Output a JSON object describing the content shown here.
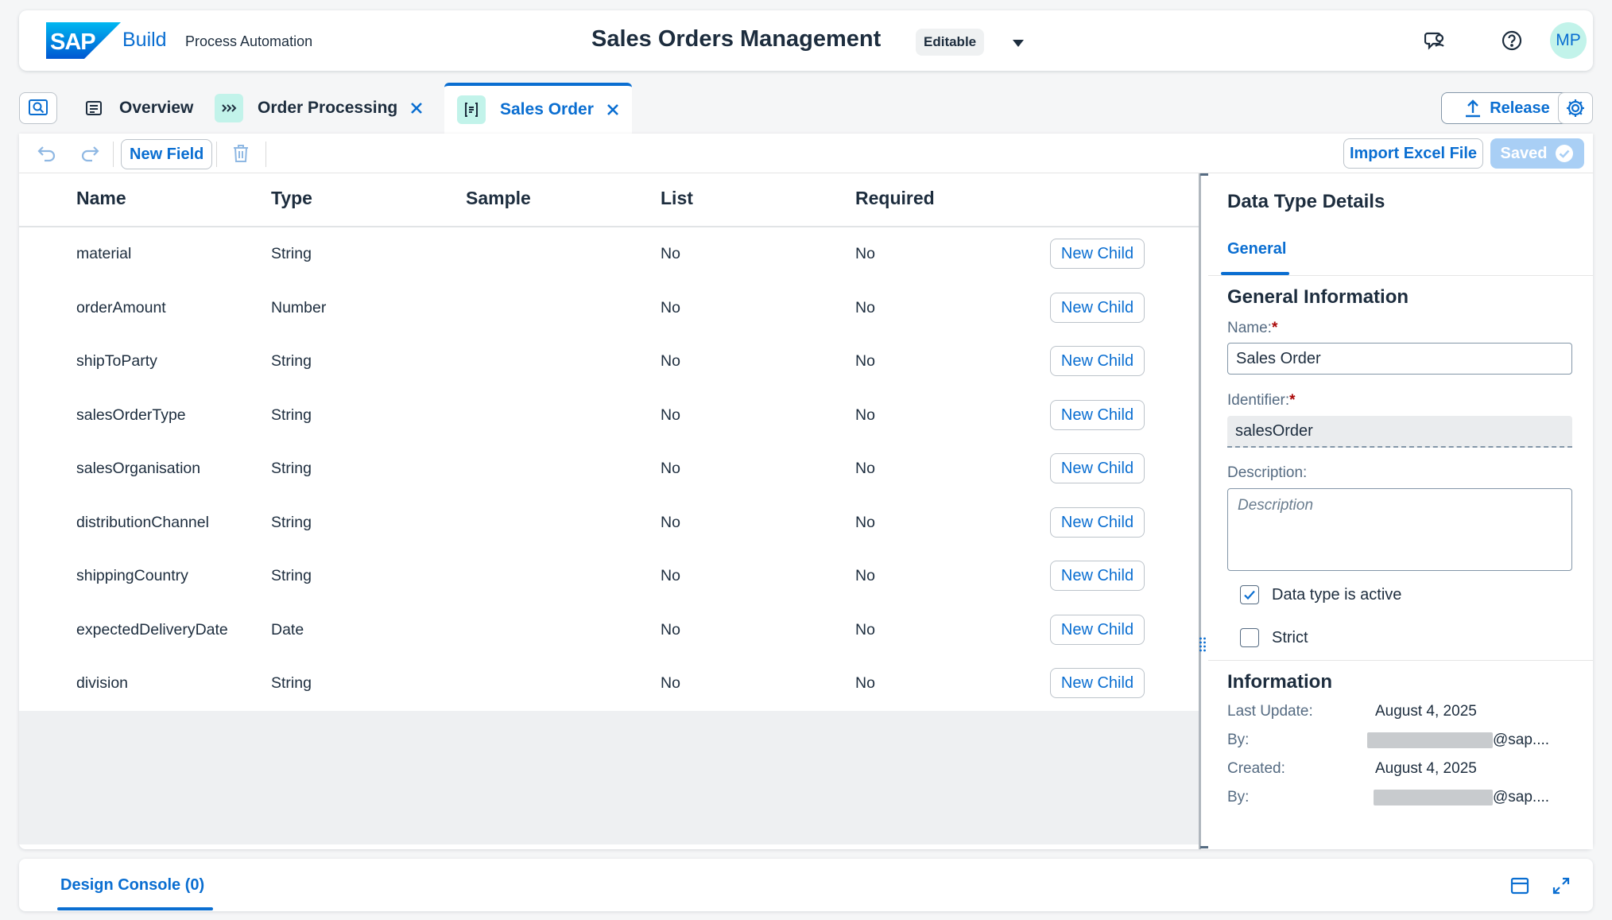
{
  "shell": {
    "brand": "SAP",
    "product": "Build",
    "subproduct": "Process Automation",
    "project_title": "Sales Orders Management",
    "status_badge": "Editable",
    "avatar_initials": "MP"
  },
  "tabs": [
    {
      "label": "Overview",
      "icon": "overview-icon",
      "closable": false,
      "active": false
    },
    {
      "label": "Order Processing",
      "icon": "process-icon",
      "closable": true,
      "active": false
    },
    {
      "label": "Sales Order",
      "icon": "data-type-icon",
      "closable": true,
      "active": true
    }
  ],
  "actions": {
    "release_label": "Release"
  },
  "toolbar": {
    "new_field_label": "New Field",
    "import_label": "Import Excel File",
    "saved_label": "Saved"
  },
  "table": {
    "columns": [
      "Name",
      "Type",
      "Sample",
      "List",
      "Required"
    ],
    "new_child_label": "New Child",
    "rows": [
      {
        "name": "material",
        "type": "String",
        "sample": "",
        "list": "No",
        "required": "No"
      },
      {
        "name": "orderAmount",
        "type": "Number",
        "sample": "",
        "list": "No",
        "required": "No"
      },
      {
        "name": "shipToParty",
        "type": "String",
        "sample": "",
        "list": "No",
        "required": "No"
      },
      {
        "name": "salesOrderType",
        "type": "String",
        "sample": "",
        "list": "No",
        "required": "No"
      },
      {
        "name": "salesOrganisation",
        "type": "String",
        "sample": "",
        "list": "No",
        "required": "No"
      },
      {
        "name": "distributionChannel",
        "type": "String",
        "sample": "",
        "list": "No",
        "required": "No"
      },
      {
        "name": "shippingCountry",
        "type": "String",
        "sample": "",
        "list": "No",
        "required": "No"
      },
      {
        "name": "expectedDeliveryDate",
        "type": "Date",
        "sample": "",
        "list": "No",
        "required": "No"
      },
      {
        "name": "division",
        "type": "String",
        "sample": "",
        "list": "No",
        "required": "No"
      }
    ]
  },
  "details": {
    "title": "Data Type Details",
    "tab_general": "General",
    "section_general": "General Information",
    "name_label": "Name:",
    "name_value": "Sales Order",
    "identifier_label": "Identifier:",
    "identifier_value": "salesOrder",
    "description_label": "Description:",
    "description_placeholder": "Description",
    "active_label": "Data type is active",
    "active_checked": true,
    "strict_label": "Strict",
    "strict_checked": false,
    "section_info": "Information",
    "last_update_label": "Last Update:",
    "last_update_value": "August 4, 2025",
    "by_label": "By:",
    "last_update_by": "@sap....",
    "created_label": "Created:",
    "created_value": "August 4, 2025",
    "created_by": "@sap...."
  },
  "console": {
    "tab_label": "Design Console (0)"
  },
  "colors": {
    "accent": "#0a6ed1",
    "saved_bg": "#a9cff5",
    "avatar_bg": "#c2f3ea",
    "required_marker": "#aa0808"
  }
}
